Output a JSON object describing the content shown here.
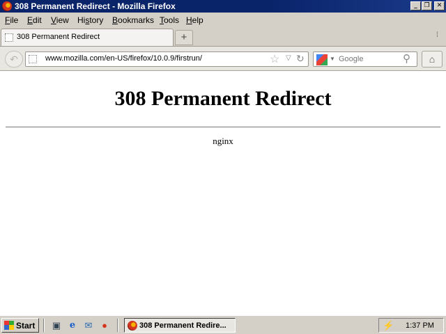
{
  "window": {
    "title": "308 Permanent Redirect - Mozilla Firefox",
    "controls": {
      "minimize": "_",
      "maximize": "❐",
      "close": "✕"
    }
  },
  "menu": {
    "items": [
      {
        "label": "File",
        "accel": "F"
      },
      {
        "label": "Edit",
        "accel": "E"
      },
      {
        "label": "View",
        "accel": "V"
      },
      {
        "label": "History",
        "accel": "s"
      },
      {
        "label": "Bookmarks",
        "accel": "B"
      },
      {
        "label": "Tools",
        "accel": "T"
      },
      {
        "label": "Help",
        "accel": "H"
      }
    ]
  },
  "tabs": {
    "items": [
      {
        "label": "308 Permanent Redirect",
        "active": true
      }
    ],
    "new_tab_glyph": "+",
    "list_glyph": "⁞"
  },
  "navbar": {
    "back_glyph": "↶",
    "url": "www.mozilla.com/en-US/firefox/10.0.9/firstrun/",
    "bookmark_star": "☆",
    "history_drop": "▽",
    "reload_glyph": "↻",
    "search": {
      "engine": "google-icon",
      "placeholder": "Google",
      "go_glyph": "⚲"
    },
    "home_glyph": "⌂"
  },
  "page": {
    "heading": "308 Permanent Redirect",
    "server": "nginx"
  },
  "taskbar": {
    "start_label": "Start",
    "quick_launch": [
      {
        "name": "show-desktop-icon",
        "glyph": "▣"
      },
      {
        "name": "internet-explorer-icon",
        "glyph": "e"
      },
      {
        "name": "outlook-express-icon",
        "glyph": "✉"
      },
      {
        "name": "firefox-icon",
        "glyph": "●"
      }
    ],
    "task": {
      "label": "308 Permanent Redire..."
    },
    "tray": {
      "clock": "1:37 PM",
      "network_glyph": "⚡"
    }
  },
  "colors": {
    "titlebar": "#0a246a",
    "chrome": "#d4d0c8",
    "navbar": "#e8e6e1"
  }
}
